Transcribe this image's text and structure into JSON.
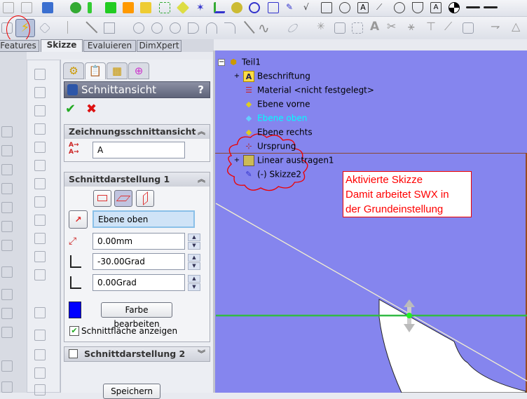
{
  "tabs": [
    {
      "label": "Features"
    },
    {
      "label": "Skizze"
    },
    {
      "label": "Evaluieren"
    },
    {
      "label": "DimXpert"
    }
  ],
  "property_manager": {
    "title": "Schnittansicht",
    "help": "?",
    "section1": {
      "title": "Zeichnungsschnittansicht",
      "name_value": "A"
    },
    "section2": {
      "title": "Schnittdarstellung 1",
      "reference_value": "Ebene oben",
      "offset_value": "0.00mm",
      "x_rotation_value": "-30.00Grad",
      "y_rotation_value": "0.00Grad",
      "color_button": "Farbe bearbeiten",
      "section_color": "#0000ff",
      "show_surface_label": "Schnittfläche anzeigen",
      "show_surface_checked": true
    },
    "section3": {
      "title": "Schnittdarstellung 2",
      "checked": false
    },
    "save_button": "Speichern"
  },
  "tree": {
    "root": "Teil1",
    "items": [
      {
        "label": "Beschriftung"
      },
      {
        "label": "Material <nicht festgelegt>"
      },
      {
        "label": "Ebene vorne"
      },
      {
        "label": "Ebene oben"
      },
      {
        "label": "Ebene rechts"
      },
      {
        "label": "Ursprung"
      },
      {
        "label": "Linear austragen1"
      },
      {
        "label": "(-) Skizze2"
      }
    ],
    "selected_color": "#00ffff"
  },
  "annotation": {
    "lines": [
      "Aktivierte Skizze",
      "Damit arbeitet SWX in",
      "der Grundeinstellung"
    ],
    "color": "#ff0000"
  },
  "colors": {
    "graphics_bg": "#8585ee",
    "accent": "#ff0000"
  }
}
